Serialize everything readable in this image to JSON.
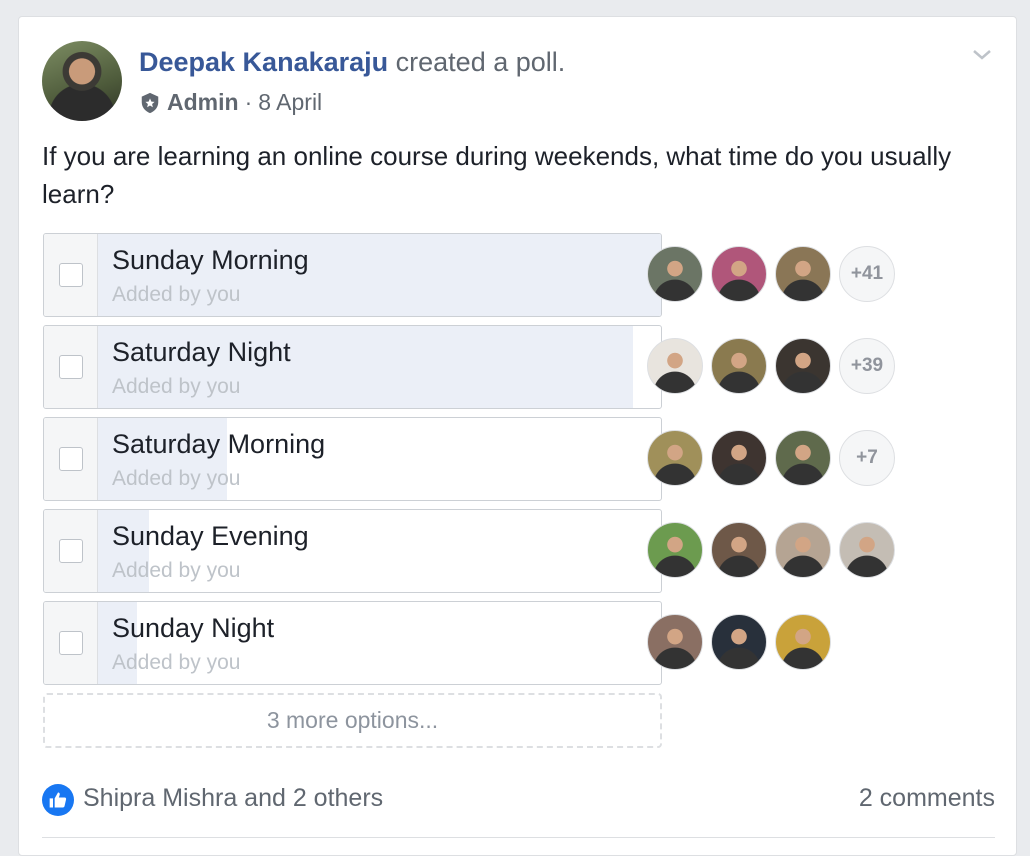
{
  "post": {
    "author": "Deepak Kanakaraju",
    "action": "created a poll.",
    "role": "Admin",
    "separator": "·",
    "date": "8 April",
    "question": "If you are learning an online course during weekends, what time do you usually learn?"
  },
  "poll": {
    "options": [
      {
        "label": "Sunday Morning",
        "added_by": "Added by you",
        "vote_share": 1.0,
        "extra_voters": "+41",
        "voter_colors": [
          "#6b7565",
          "#b0567a",
          "#8a7656"
        ]
      },
      {
        "label": "Saturday Night",
        "added_by": "Added by you",
        "vote_share": 0.95,
        "extra_voters": "+39",
        "voter_colors": [
          "#e8e4de",
          "#8a7a4f",
          "#3b3530"
        ]
      },
      {
        "label": "Saturday Morning",
        "added_by": "Added by you",
        "vote_share": 0.23,
        "extra_voters": "+7",
        "voter_colors": [
          "#a0905a",
          "#3e3430",
          "#5f6a4c"
        ]
      },
      {
        "label": "Sunday Evening",
        "added_by": "Added by you",
        "vote_share": 0.09,
        "extra_voters": "",
        "voter_colors": [
          "#6c9b4f",
          "#6e5848",
          "#b5a493",
          "#c4bdb4"
        ]
      },
      {
        "label": "Sunday Night",
        "added_by": "Added by you",
        "vote_share": 0.07,
        "extra_voters": "",
        "voter_colors": [
          "#8a6f63",
          "#28303b",
          "#c9a23a"
        ]
      }
    ],
    "more_options": "3 more options..."
  },
  "footer": {
    "likers": "Shipra Mishra and 2 others",
    "comments": "2 comments"
  },
  "colors": {
    "link": "#385898",
    "like_blue": "#1877f2",
    "poll_fill": "#ebeff7"
  }
}
